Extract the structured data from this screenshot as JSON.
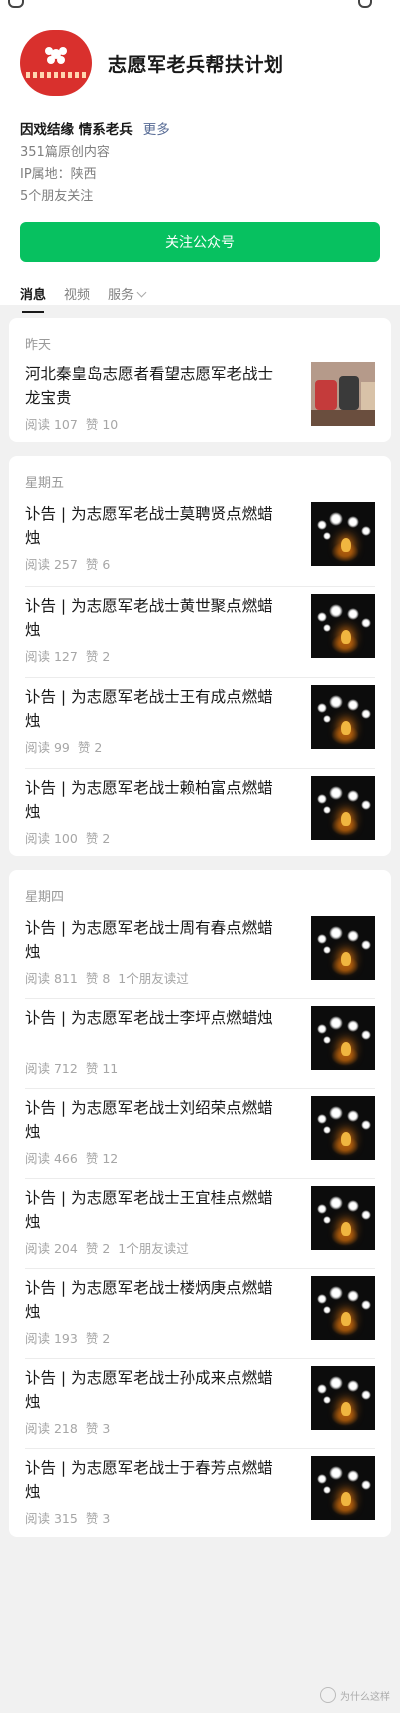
{
  "account": {
    "name": "志愿军老兵帮扶计划",
    "tagline": "因戏结缘 情系老兵",
    "more_label": "更多",
    "original_count": "351篇原创内容",
    "ip_location": "IP属地：陕西",
    "friends_following": "5个朋友关注",
    "follow_button": "关注公众号"
  },
  "tabs": [
    {
      "label": "消息"
    },
    {
      "label": "视频"
    },
    {
      "label": "服务"
    }
  ],
  "groups": [
    {
      "day": "昨天",
      "items": [
        {
          "title": "河北秦皇岛志愿者看望志愿军老战士龙宝贵",
          "reads": "阅读 107",
          "likes": "赞 10",
          "friends": "",
          "thumb": "photo"
        }
      ]
    },
    {
      "day": "星期五",
      "items": [
        {
          "title": "讣告 | 为志愿军老战士莫聘贤点燃蜡烛",
          "reads": "阅读 257",
          "likes": "赞 6",
          "friends": "",
          "thumb": "candle"
        },
        {
          "title": "讣告 | 为志愿军老战士黄世聚点燃蜡烛",
          "reads": "阅读 127",
          "likes": "赞 2",
          "friends": "",
          "thumb": "candle"
        },
        {
          "title": "讣告 | 为志愿军老战士王有成点燃蜡烛",
          "reads": "阅读 99",
          "likes": "赞 2",
          "friends": "",
          "thumb": "candle"
        },
        {
          "title": "讣告 | 为志愿军老战士赖柏富点燃蜡烛",
          "reads": "阅读 100",
          "likes": "赞 2",
          "friends": "",
          "thumb": "candle"
        }
      ]
    },
    {
      "day": "星期四",
      "items": [
        {
          "title": "讣告 | 为志愿军老战士周有春点燃蜡烛",
          "reads": "阅读 811",
          "likes": "赞 8",
          "friends": "1个朋友读过",
          "thumb": "candle"
        },
        {
          "title": "讣告 | 为志愿军老战士李坪点燃蜡烛",
          "reads": "阅读 712",
          "likes": "赞 11",
          "friends": "",
          "thumb": "candle"
        },
        {
          "title": "讣告 | 为志愿军老战士刘绍荣点燃蜡烛",
          "reads": "阅读 466",
          "likes": "赞 12",
          "friends": "",
          "thumb": "candle"
        },
        {
          "title": "讣告 | 为志愿军老战士王宜桂点燃蜡烛",
          "reads": "阅读 204",
          "likes": "赞 2",
          "friends": "1个朋友读过",
          "thumb": "candle"
        },
        {
          "title": "讣告 | 为志愿军老战士楼炳庚点燃蜡烛",
          "reads": "阅读 193",
          "likes": "赞 2",
          "friends": "",
          "thumb": "candle"
        },
        {
          "title": "讣告 | 为志愿军老战士孙成来点燃蜡烛",
          "reads": "阅读 218",
          "likes": "赞 3",
          "friends": "",
          "thumb": "candle"
        },
        {
          "title": "讣告 | 为志愿军老战士于春芳点燃蜡烛",
          "reads": "阅读 315",
          "likes": "赞 3",
          "friends": "",
          "thumb": "candle"
        }
      ]
    }
  ],
  "watermark": "为什么这样"
}
